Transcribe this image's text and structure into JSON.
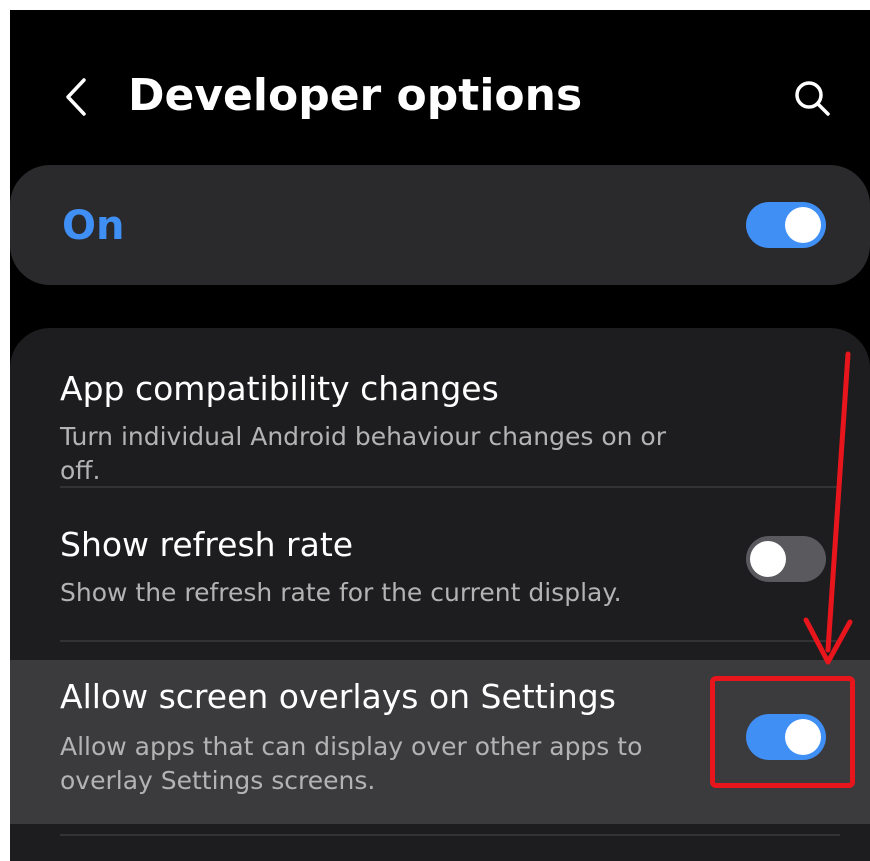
{
  "header": {
    "title": "Developer options",
    "back_icon": "chevron-left-icon",
    "search_icon": "search-icon"
  },
  "master_switch": {
    "label": "On",
    "state": true
  },
  "settings": [
    {
      "title": "App compatibility changes",
      "subtitle": "Turn individual Android behaviour changes on or off."
    },
    {
      "title": "Show refresh rate",
      "subtitle": "Show the refresh rate for the current display.",
      "toggle": false
    },
    {
      "title": "Allow screen overlays on Settings",
      "subtitle": "Allow apps that can display over other apps to overlay Settings screens.",
      "toggle": true
    }
  ],
  "colors": {
    "accent": "#3f8ff5",
    "background": "#000000",
    "card": "#1d1d1f",
    "highlight_row": "#3b3b3e",
    "annotation": "#e8161c"
  }
}
